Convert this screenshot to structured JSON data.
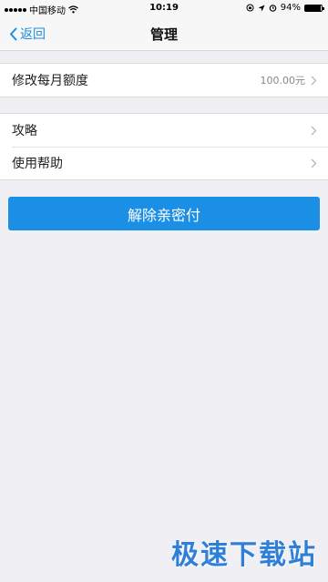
{
  "status_bar": {
    "carrier": "中国移动",
    "time": "10:19",
    "battery": "94%",
    "battery_level": 0.94
  },
  "nav": {
    "back_label": "返回",
    "title": "管理"
  },
  "settings": {
    "limit": {
      "label": "修改每月额度",
      "value": "100.00元"
    },
    "items": [
      {
        "label": "攻略"
      },
      {
        "label": "使用帮助"
      }
    ]
  },
  "actions": {
    "unbind_label": "解除亲密付"
  },
  "watermark": {
    "text": "极速下载站"
  },
  "colors": {
    "accent": "#1b8fe6",
    "background": "#efeff4"
  }
}
